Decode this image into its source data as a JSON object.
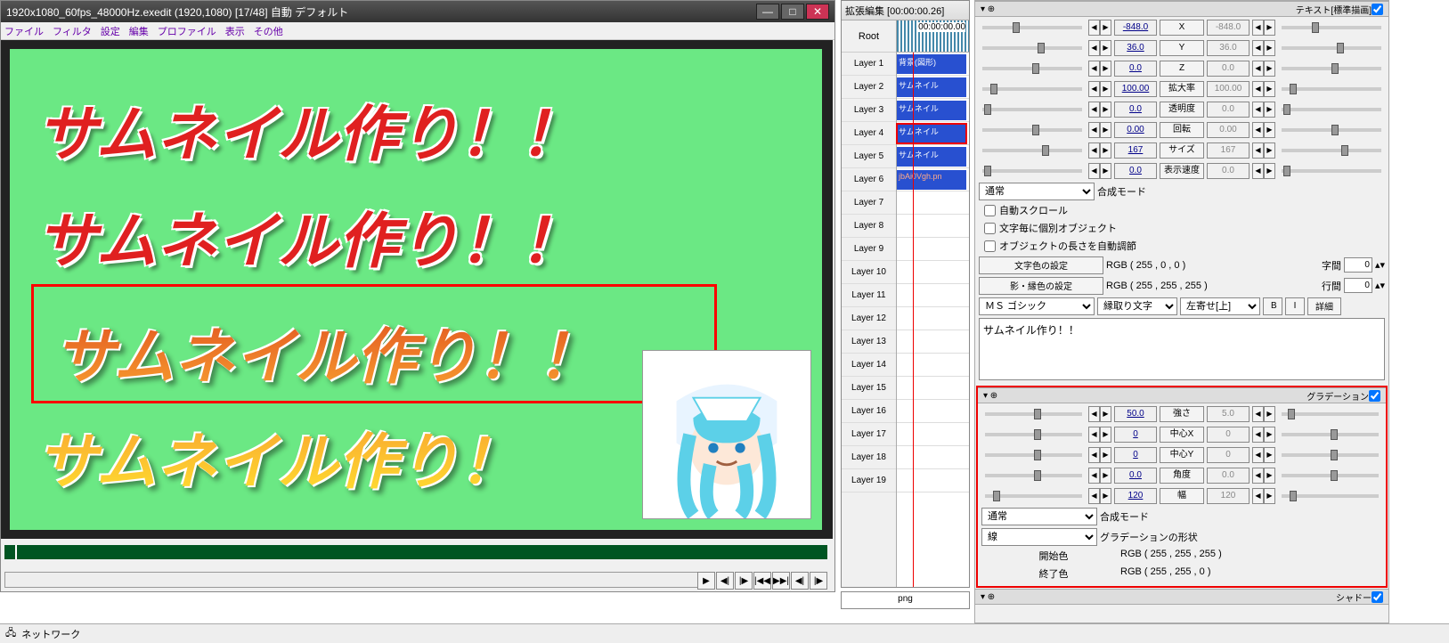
{
  "title": "1920x1080_60fps_48000Hz.exedit (1920,1080)  [17/48]  自動  デフォルト",
  "menu": [
    "ファイル",
    "フィルタ",
    "設定",
    "編集",
    "プロファイル",
    "表示",
    "その他"
  ],
  "preview_texts": {
    "t1": "サムネイル作り！！",
    "t2": "サムネイル作り！！",
    "t3": "サムネイル作り！！",
    "t4": "サムネイル作り！"
  },
  "timeline": {
    "title": "拡張編集 [00:00:00.26]",
    "root": "Root",
    "time": "00:00:00.00",
    "layers": [
      "Layer  1",
      "Layer  2",
      "Layer  3",
      "Layer  4",
      "Layer  5",
      "Layer  6",
      "Layer  7",
      "Layer  8",
      "Layer  9",
      "Layer 10",
      "Layer 11",
      "Layer 12",
      "Layer 13",
      "Layer 14",
      "Layer 15",
      "Layer 16",
      "Layer 17",
      "Layer 18",
      "Layer 19"
    ],
    "clips": [
      "背景(図形)",
      "サムネイル",
      "サムネイル",
      "サムネイル",
      "サムネイル",
      "jbAi0Vgh.pn"
    ],
    "filetab": "png"
  },
  "props": {
    "header_right": "テキスト[標準描画]",
    "params": [
      {
        "name": "X",
        "v1": "-848.0",
        "v2": "-848.0",
        "t1": 30,
        "t2": 30
      },
      {
        "name": "Y",
        "v1": "36.0",
        "v2": "36.0",
        "t1": 55,
        "t2": 55
      },
      {
        "name": "Z",
        "v1": "0.0",
        "v2": "0.0",
        "t1": 50,
        "t2": 50
      },
      {
        "name": "拡大率",
        "v1": "100.00",
        "v2": "100.00",
        "t1": 8,
        "t2": 8
      },
      {
        "name": "透明度",
        "v1": "0.0",
        "v2": "0.0",
        "t1": 2,
        "t2": 2
      },
      {
        "name": "回転",
        "v1": "0.00",
        "v2": "0.00",
        "t1": 50,
        "t2": 50
      },
      {
        "name": "サイズ",
        "v1": "167",
        "v2": "167",
        "t1": 60,
        "t2": 60
      },
      {
        "name": "表示速度",
        "v1": "0.0",
        "v2": "0.0",
        "t1": 2,
        "t2": 2
      }
    ],
    "blend_label": "合成モード",
    "blend_value": "通常",
    "chk1": "自動スクロール",
    "chk2": "文字毎に個別オブジェクト",
    "chk3": "オブジェクトの長さを自動調節",
    "color_btn": "文字色の設定",
    "color_val": "RGB ( 255 , 0 , 0 )",
    "shadow_btn": "影・縁色の設定",
    "shadow_val": "RGB ( 255 , 255 , 255 )",
    "spacing_lbl": "字間",
    "spacing_val": "0",
    "line_lbl": "行間",
    "line_val": "0",
    "font": "ＭＳ ゴシック",
    "outline": "縁取り文字",
    "align": "左寄せ[上]",
    "bold": "B",
    "ital": "I",
    "detail": "詳細",
    "text_content": "サムネイル作り！！",
    "grad_title": "グラデーション",
    "grad_params": [
      {
        "name": "強さ",
        "v1": "50.0",
        "v2": "5.0",
        "t1": 50,
        "t2": 6
      },
      {
        "name": "中心X",
        "v1": "0",
        "v2": "0",
        "t1": 50,
        "t2": 50
      },
      {
        "name": "中心Y",
        "v1": "0",
        "v2": "0",
        "t1": 50,
        "t2": 50
      },
      {
        "name": "角度",
        "v1": "0.0",
        "v2": "0.0",
        "t1": 50,
        "t2": 50
      },
      {
        "name": "幅",
        "v1": "120",
        "v2": "120",
        "t1": 8,
        "t2": 8
      }
    ],
    "grad_blend": "通常",
    "grad_blend_lbl": "合成モード",
    "grad_shape": "線",
    "grad_shape_lbl": "グラデーションの形状",
    "start_color_lbl": "開始色",
    "start_color": "RGB ( 255 , 255 , 255 )",
    "end_color_lbl": "終了色",
    "end_color": "RGB ( 255 , 255 , 0 )",
    "shadow_sect": "シャドー"
  },
  "taskbar": {
    "net": "ネットワーク"
  }
}
